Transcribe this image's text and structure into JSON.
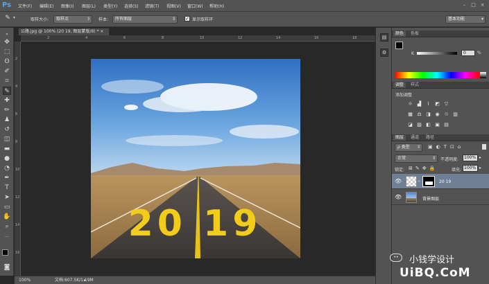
{
  "app": {
    "logo": "Ps"
  },
  "menu": [
    "文件(F)",
    "编辑(E)",
    "图像(I)",
    "图层(L)",
    "类型(Y)",
    "选择(S)",
    "滤镜(T)",
    "视图(V)",
    "窗口(W)",
    "帮助(H)"
  ],
  "window_controls": {
    "minimize": "–",
    "maximize": "□",
    "close": "×"
  },
  "options": {
    "size_label": "取样大小:",
    "size_value": "取样点",
    "sample_label": "样本:",
    "sample_value": "所有图层",
    "show_ring": "显示取样环",
    "workspace": "基本功能"
  },
  "document": {
    "tab_title": "公路.jpg @ 100% (20 19, 图层蒙版/8) * ×",
    "ruler_top": [
      "2",
      "4",
      "6",
      "8",
      "10",
      "12",
      "14",
      "16",
      "18"
    ],
    "ruler_left": [
      "2",
      "4",
      "6",
      "8",
      "10",
      "12",
      "14",
      "16"
    ],
    "road_text": "20 19"
  },
  "status": {
    "zoom": "100%",
    "doc_size": "文档:607.5K/1.19M"
  },
  "color_panel": {
    "tabs": [
      "颜色",
      "色板"
    ],
    "channel": "K",
    "value": "0",
    "unit": "%"
  },
  "adjust_panel": {
    "tabs": [
      "调整",
      "样式"
    ],
    "title": "添加调整"
  },
  "layers_panel": {
    "tabs": [
      "图层",
      "通道",
      "路径"
    ],
    "filter": "ρ 类型",
    "blend": "正常",
    "opacity_label": "不透明度:",
    "opacity": "100%",
    "lock_label": "锁定:",
    "fill_label": "填充:",
    "fill": "100%",
    "layers": [
      {
        "name": "20 19",
        "selected": true
      },
      {
        "name": "背景图层",
        "selected": false
      }
    ]
  },
  "watermark": {
    "text": "小钱学设计",
    "site": "UiBQ.CoM"
  },
  "colors": {
    "chrome": "#535353",
    "dark": "#282828",
    "selected_layer": "#6f7f96",
    "road_text": "#f1cc19"
  }
}
